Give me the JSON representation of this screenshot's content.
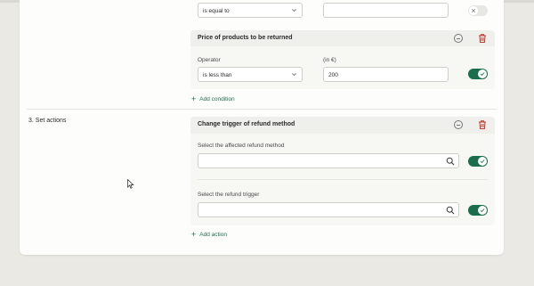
{
  "condition_top": {
    "operator_value": "is equal to",
    "value_input": ""
  },
  "condition_price": {
    "title": "Price of products to be returned",
    "operator_label": "Operator",
    "operator_value": "is less than",
    "value_label": "(in €)",
    "value_input": "200"
  },
  "add_condition_label": "Add condition",
  "section3": {
    "title": "3. Set actions"
  },
  "action_refund": {
    "title": "Change trigger of refund method",
    "field1_label": "Select the affected refund method",
    "field1_value": "",
    "field2_label": "Select the refund trigger",
    "field2_value": ""
  },
  "add_action_label": "Add action",
  "colors": {
    "accent": "#1b6e4b",
    "danger": "#c0392b",
    "background": "#eae9e3",
    "card": "#fdfdfb"
  }
}
